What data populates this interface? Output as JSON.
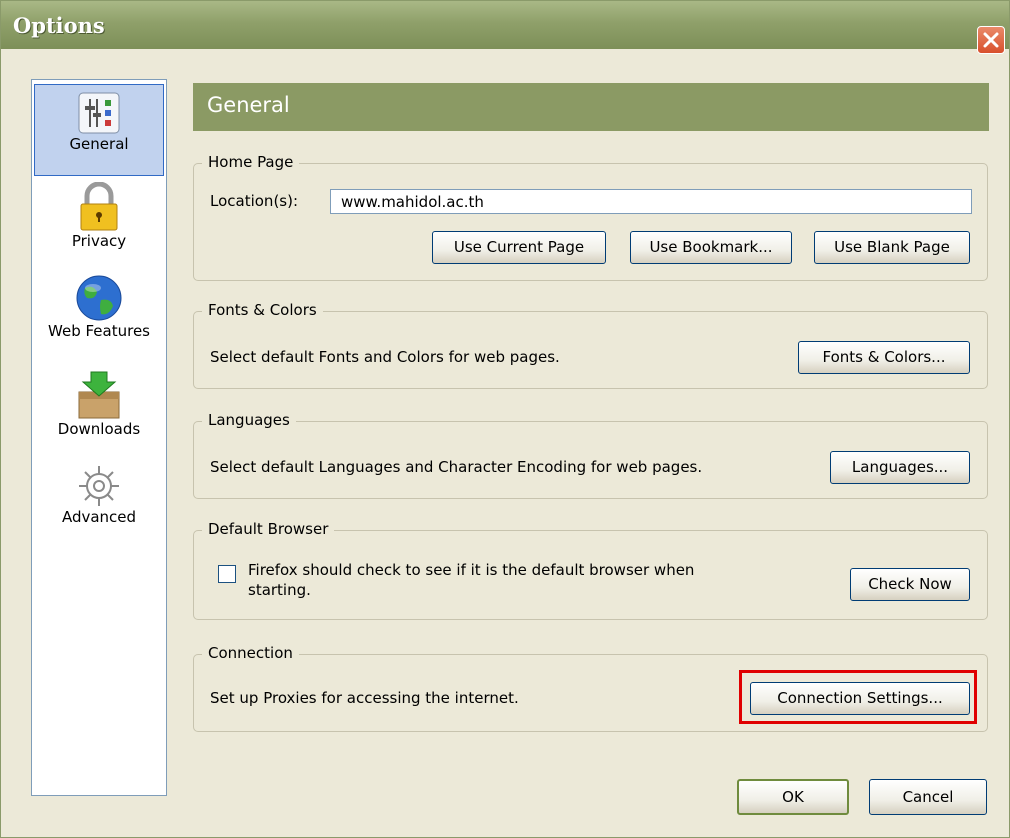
{
  "window": {
    "title": "Options"
  },
  "sidebar": {
    "items": [
      {
        "label": "General",
        "icon": "general-settings-icon",
        "selected": true
      },
      {
        "label": "Privacy",
        "icon": "padlock-icon",
        "selected": false
      },
      {
        "label": "Web Features",
        "icon": "globe-icon",
        "selected": false
      },
      {
        "label": "Downloads",
        "icon": "download-box-icon",
        "selected": false
      },
      {
        "label": "Advanced",
        "icon": "gear-icon",
        "selected": false
      }
    ]
  },
  "header": {
    "title": "General"
  },
  "home_page": {
    "legend": "Home Page",
    "location_label": "Location(s):",
    "location_value": "www.mahidol.ac.th",
    "buttons": {
      "use_current": "Use Current Page",
      "use_bookmark": "Use Bookmark...",
      "use_blank": "Use Blank Page"
    }
  },
  "fonts_colors": {
    "legend": "Fonts & Colors",
    "description": "Select default Fonts and Colors for web pages.",
    "button": "Fonts & Colors..."
  },
  "languages": {
    "legend": "Languages",
    "description": "Select default Languages and Character Encoding for web pages.",
    "button": "Languages..."
  },
  "default_browser": {
    "legend": "Default Browser",
    "checkbox_line1": "Firefox should check to see if it is the default browser when",
    "checkbox_line2": "starting.",
    "checked": false,
    "button": "Check Now"
  },
  "connection": {
    "legend": "Connection",
    "description": "Set up Proxies for accessing the internet.",
    "button": "Connection Settings...",
    "highlight_color": "#e00000"
  },
  "footer": {
    "ok": "OK",
    "cancel": "Cancel"
  }
}
